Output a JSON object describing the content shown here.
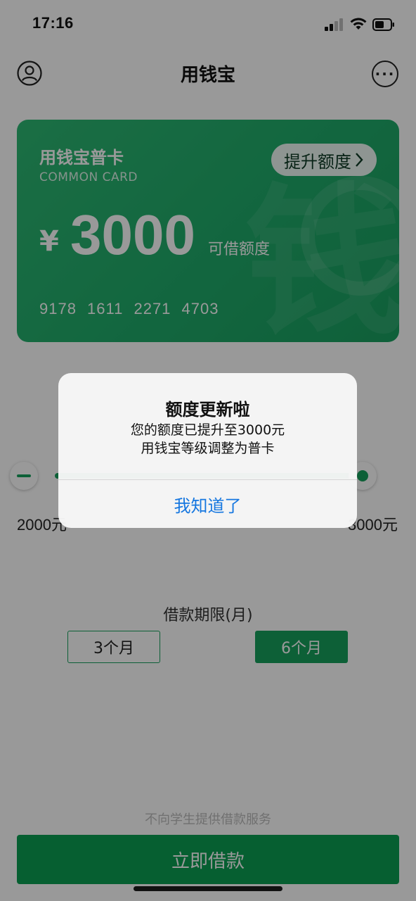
{
  "status_bar": {
    "time": "17:16"
  },
  "header": {
    "title": "用钱宝",
    "user_icon": "user-icon",
    "more_icon": "more-icon",
    "more_glyph": "···"
  },
  "card": {
    "title": "用钱宝普卡",
    "subtitle": "COMMON CARD",
    "raise_label": "提升额度",
    "currency": "¥",
    "amount": "3000",
    "amount_label": "可借额度",
    "card_number": "9178 1611 2271 4703",
    "watermark": "钱",
    "color": "#22ad6a"
  },
  "slider": {
    "min_label": "2000元",
    "max_label": "3000元"
  },
  "term": {
    "title": "借款期限(月)",
    "options": [
      {
        "label": "3个月",
        "selected": false
      },
      {
        "label": "6个月",
        "selected": true
      }
    ]
  },
  "footer": {
    "notice": "不向学生提供借款服务",
    "borrow_label": "立即借款",
    "accent": "#0a9f52"
  },
  "dialog": {
    "title": "额度更新啦",
    "lines": [
      "您的额度已提升至3000元",
      "用钱宝等级调整为普卡"
    ],
    "confirm_label": "我知道了",
    "confirm_color": "#1677e0"
  }
}
